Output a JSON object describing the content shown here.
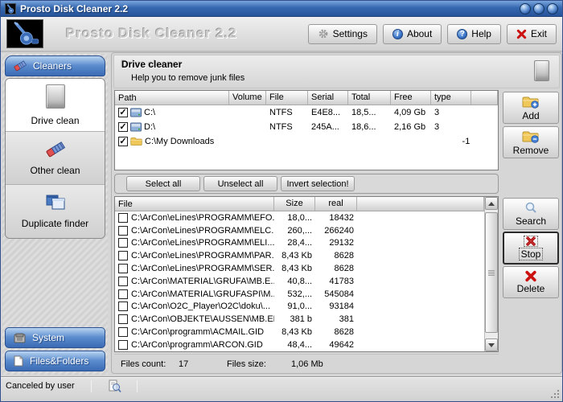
{
  "window": {
    "title": "Prosto Disk Cleaner 2.2",
    "status_text": "Canceled by user"
  },
  "header": {
    "app_title": "Prosto Disk Cleaner 2.2",
    "settings": "Settings",
    "about": "About",
    "help": "Help",
    "exit": "Exit"
  },
  "sidebar": {
    "cleaners": "Cleaners",
    "drive_clean": "Drive clean",
    "other_clean": "Other clean",
    "duplicate_finder": "Duplicate finder",
    "system": "System",
    "files_folders": "Files&Folders"
  },
  "main": {
    "title": "Drive cleaner",
    "subtitle": "Help you to remove junk files",
    "drive_table": {
      "columns": {
        "path": "Path",
        "volume": "Volume",
        "file": "File",
        "serial": "Serial",
        "total": "Total",
        "free": "Free",
        "type": "type"
      },
      "rows": [
        {
          "checked": true,
          "icon": "drive",
          "path": "C:\\",
          "volume": "",
          "file": "NTFS",
          "serial": "E4E8...",
          "total": "18,5...",
          "free": "4,09 Gb",
          "type": "3"
        },
        {
          "checked": true,
          "icon": "drive",
          "path": "D:\\",
          "volume": "",
          "file": "NTFS",
          "serial": "245A...",
          "total": "18,6...",
          "free": "2,16 Gb",
          "type": "3"
        },
        {
          "checked": true,
          "icon": "folder",
          "path": "C:\\My Downloads",
          "volume": "",
          "file": "",
          "serial": "",
          "total": "",
          "free": "",
          "type": "-1"
        }
      ]
    },
    "toolbar": {
      "select_all": "Select all",
      "unselect_all": "Unselect all",
      "invert_selection": "Invert selection!"
    },
    "file_table": {
      "columns": {
        "file": "File",
        "size": "Size",
        "real": "real"
      },
      "rows": [
        {
          "checked": false,
          "file": "C:\\ArCon\\eLines\\PROGRAMM\\EFO...",
          "size": "18,0...",
          "real": "18432"
        },
        {
          "checked": false,
          "file": "C:\\ArCon\\eLines\\PROGRAMM\\ELC...",
          "size": "260,...",
          "real": "266240"
        },
        {
          "checked": false,
          "file": "C:\\ArCon\\eLines\\PROGRAMM\\ELI...",
          "size": "28,4...",
          "real": "29132"
        },
        {
          "checked": false,
          "file": "C:\\ArCon\\eLines\\PROGRAMM\\PAR...",
          "size": "8,43 Kb",
          "real": "8628"
        },
        {
          "checked": false,
          "file": "C:\\ArCon\\eLines\\PROGRAMM\\SER...",
          "size": "8,43 Kb",
          "real": "8628"
        },
        {
          "checked": false,
          "file": "C:\\ArCon\\MATERIAL\\GRUFA\\MB.E...",
          "size": "40,8...",
          "real": "41783"
        },
        {
          "checked": false,
          "file": "C:\\ArCon\\MATERIAL\\GRUFASPI\\M...",
          "size": "532,...",
          "real": "545084"
        },
        {
          "checked": false,
          "file": "C:\\ArCon\\O2C_Player\\O2C\\doku\\...",
          "size": "91,0...",
          "real": "93184"
        },
        {
          "checked": false,
          "file": "C:\\ArCon\\OBJEKTE\\AUSSEN\\MB.ERR",
          "size": "381 b",
          "real": "381"
        },
        {
          "checked": false,
          "file": "C:\\ArCon\\programm\\ACMAIL.GID",
          "size": "8,43 Kb",
          "real": "8628"
        },
        {
          "checked": false,
          "file": "C:\\ArCon\\programm\\ARCON.GID",
          "size": "48,4...",
          "real": "49642"
        }
      ]
    },
    "buttons": {
      "add": "Add",
      "remove": "Remove",
      "search": "Search",
      "stop": "Stop",
      "delete": "Delete"
    },
    "summary": {
      "files_count_label": "Files count:",
      "files_count": "17",
      "files_size_label": "Files size:",
      "files_size": "1,06 Mb"
    }
  },
  "colors": {
    "titlebar_blue": "#3568b0",
    "accent_blue": "#4a7cc4",
    "danger_red": "#cc1111",
    "folder_yellow": "#f0c85a"
  }
}
